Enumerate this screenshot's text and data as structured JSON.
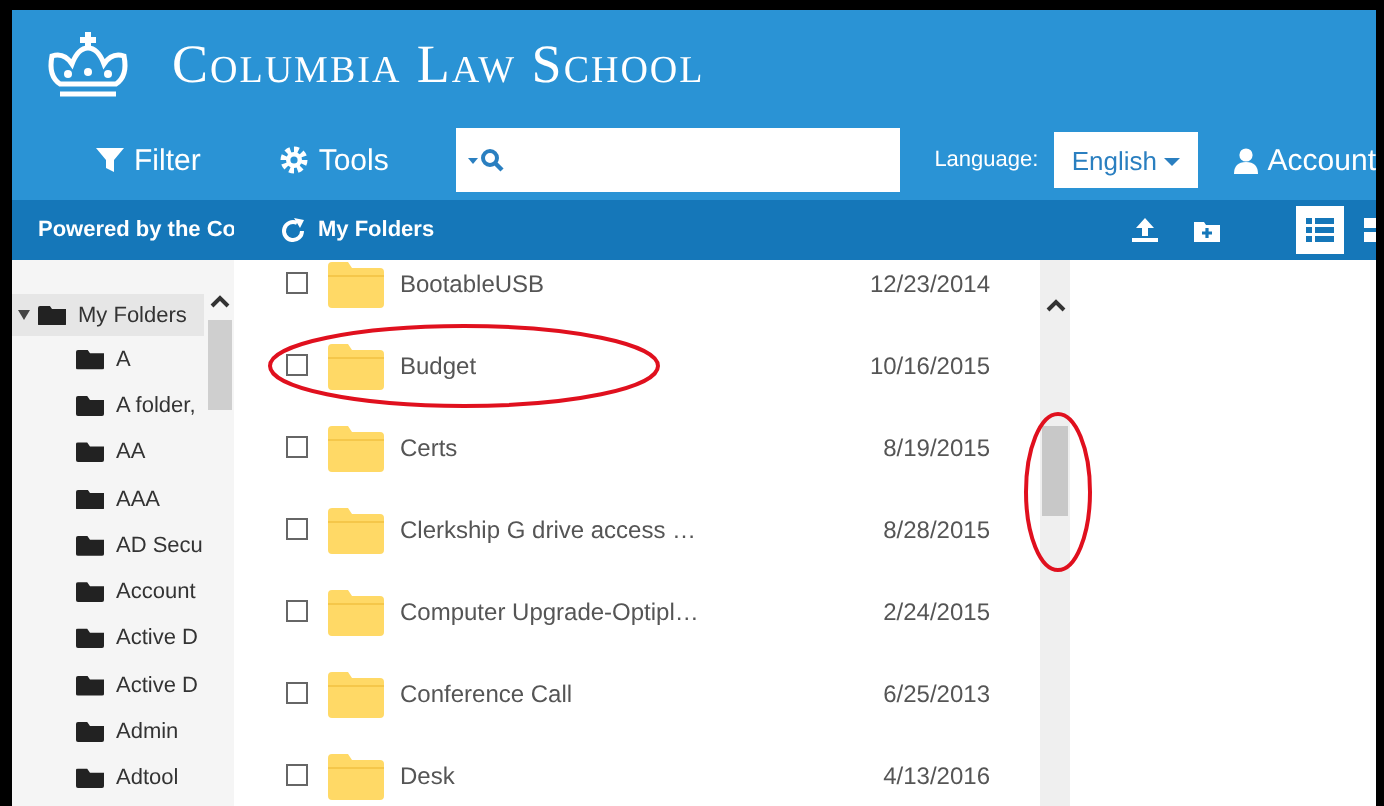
{
  "header": {
    "title": "Columbia Law School"
  },
  "nav": {
    "filter": "Filter",
    "tools": "Tools",
    "language_label": "Language:",
    "language": "English",
    "account": "Account"
  },
  "toolbar": {
    "powered_by": "Powered by the Co",
    "location": "My Folders",
    "list_view_selected": true
  },
  "sidebar": {
    "items": [
      {
        "label": "My Folders",
        "expanded": true,
        "selected": true,
        "children": [
          {
            "label": "A"
          },
          {
            "label": "A folder,"
          },
          {
            "label": "AA"
          },
          {
            "label": "AAA"
          },
          {
            "label": "AD Secu"
          },
          {
            "label": "Account"
          },
          {
            "label": "Active D"
          },
          {
            "label": "Active D"
          },
          {
            "label": "Admin"
          },
          {
            "label": "Adtool"
          }
        ]
      }
    ]
  },
  "files": [
    {
      "name": "BootableUSB",
      "date": "12/23/2014",
      "checked": false,
      "highlighted": false
    },
    {
      "name": "Budget",
      "date": "10/16/2015",
      "checked": false,
      "highlighted": true
    },
    {
      "name": "Certs",
      "date": "8/19/2015",
      "checked": false,
      "highlighted": false
    },
    {
      "name": "Clerkship G drive access …",
      "date": "8/28/2015",
      "checked": false,
      "highlighted": false
    },
    {
      "name": "Computer Upgrade-Optipl…",
      "date": "2/24/2015",
      "checked": false,
      "highlighted": false
    },
    {
      "name": "Conference Call",
      "date": "6/25/2013",
      "checked": false,
      "highlighted": false
    },
    {
      "name": "Desk",
      "date": "4/13/2016",
      "checked": false,
      "highlighted": false
    }
  ],
  "scrollbar_highlighted": true
}
